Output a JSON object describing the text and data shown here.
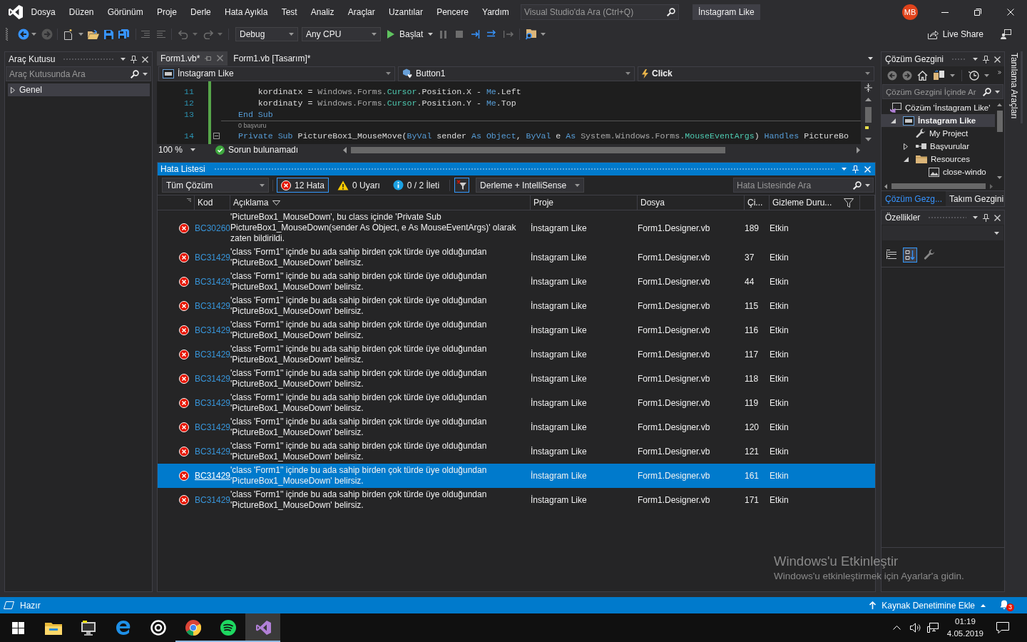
{
  "title_bar": {
    "menu": [
      "Dosya",
      "Düzen",
      "Görünüm",
      "Proje",
      "Derle",
      "Hata Ayıkla",
      "Test",
      "Analiz",
      "Araçlar",
      "Uzantılar",
      "Pencere",
      "Yardım"
    ],
    "search": {
      "placeholder": "Visual Studio'da Ara (Ctrl+Q)"
    },
    "solution_name": "İnstagram Like",
    "avatar": "MB"
  },
  "toolbar": {
    "configuration": "Debug",
    "platform": "Any CPU",
    "start": "Başlat",
    "live_share": "Live Share"
  },
  "toolbox": {
    "title": "Araç Kutusu",
    "search": {
      "placeholder": "Araç Kutusunda Ara"
    },
    "groups": [
      {
        "label": "Genel",
        "expanded": false
      }
    ]
  },
  "editor": {
    "tabs": [
      {
        "label": "Form1.vb*",
        "selected": true
      },
      {
        "label": "Form1.vb [Tasarım]*",
        "selected": false
      }
    ],
    "project": "İnstagram Like",
    "object": "Button1",
    "event": "Click",
    "lines": [
      {
        "number": "11",
        "collapsible": false,
        "tokens": [
          {
            "kind": "plain",
            "text": "    kordinatx = "
          },
          {
            "kind": "namespace",
            "text": "Windows.Forms."
          },
          {
            "kind": "type",
            "text": "Cursor"
          },
          {
            "kind": "plain",
            "text": ".Position.X - "
          },
          {
            "kind": "keyword",
            "text": "Me"
          },
          {
            "kind": "plain",
            "text": ".Left"
          }
        ]
      },
      {
        "number": "12",
        "collapsible": false,
        "tokens": [
          {
            "kind": "plain",
            "text": "    kordinaty = "
          },
          {
            "kind": "namespace",
            "text": "Windows.Forms."
          },
          {
            "kind": "type",
            "text": "Cursor"
          },
          {
            "kind": "plain",
            "text": ".Position.Y - "
          },
          {
            "kind": "keyword",
            "text": "Me"
          },
          {
            "kind": "plain",
            "text": ".Top"
          }
        ]
      },
      {
        "number": "13",
        "collapsible": false,
        "tokens": [
          {
            "kind": "keyword",
            "text": "End Sub"
          }
        ]
      },
      {
        "number": "14",
        "collapsible": true,
        "codelens": "0 başvuru",
        "tokens": [
          {
            "kind": "keyword",
            "text": "Private Sub"
          },
          {
            "kind": "plain",
            "text": " PictureBox1_MouseMove("
          },
          {
            "kind": "keyword",
            "text": "ByVal"
          },
          {
            "kind": "plain",
            "text": " sender "
          },
          {
            "kind": "keyword",
            "text": "As Object"
          },
          {
            "kind": "plain",
            "text": ", "
          },
          {
            "kind": "keyword",
            "text": "ByVal"
          },
          {
            "kind": "plain",
            "text": " e "
          },
          {
            "kind": "keyword",
            "text": "As"
          },
          {
            "kind": "namespace",
            "text": " System.Windows.Forms."
          },
          {
            "kind": "type",
            "text": "MouseEventArgs"
          },
          {
            "kind": "plain",
            "text": ") "
          },
          {
            "kind": "keyword",
            "text": "Handles"
          },
          {
            "kind": "plain",
            "text": " PictureBo"
          }
        ]
      }
    ],
    "zoom": "100 %",
    "status": "Sorun bulunamadı"
  },
  "error_list": {
    "title": "Hata Listesi",
    "scope": "Tüm Çözüm",
    "filters": [
      {
        "kind": "error",
        "label": "12 Hata",
        "selected": true
      },
      {
        "kind": "warning",
        "label": "0 Uyarı",
        "selected": false
      },
      {
        "kind": "info",
        "label": "0 / 2 İleti",
        "selected": false
      }
    ],
    "source": "Derleme + IntelliSense",
    "search": {
      "placeholder": "Hata Listesinde Ara"
    },
    "columns": [
      "Kod",
      "Açıklama",
      "Proje",
      "Dosya",
      "Çi...",
      "Gizleme Duru..."
    ],
    "rows": [
      {
        "code": "BC30260",
        "description": "'PictureBox1_MouseDown', bu class içinde 'Private Sub PictureBox1_MouseDown(sender As Object, e As MouseEventArgs)' olarak zaten bildirildi.",
        "project": "İnstagram Like",
        "file": "Form1.Designer.vb",
        "line": "189",
        "suppression": "Etkin",
        "selected": false
      },
      {
        "code": "BC31429",
        "description": "'class 'Form1'' içinde bu ada sahip birden çok türde üye olduğundan 'PictureBox1_MouseDown' belirsiz.",
        "project": "İnstagram Like",
        "file": "Form1.Designer.vb",
        "line": "37",
        "suppression": "Etkin",
        "selected": false
      },
      {
        "code": "BC31429",
        "description": "'class 'Form1'' içinde bu ada sahip birden çok türde üye olduğundan 'PictureBox1_MouseDown' belirsiz.",
        "project": "İnstagram Like",
        "file": "Form1.Designer.vb",
        "line": "44",
        "suppression": "Etkin",
        "selected": false
      },
      {
        "code": "BC31429",
        "description": "'class 'Form1'' içinde bu ada sahip birden çok türde üye olduğundan 'PictureBox1_MouseDown' belirsiz.",
        "project": "İnstagram Like",
        "file": "Form1.Designer.vb",
        "line": "115",
        "suppression": "Etkin",
        "selected": false
      },
      {
        "code": "BC31429",
        "description": "'class 'Form1'' içinde bu ada sahip birden çok türde üye olduğundan 'PictureBox1_MouseDown' belirsiz.",
        "project": "İnstagram Like",
        "file": "Form1.Designer.vb",
        "line": "116",
        "suppression": "Etkin",
        "selected": false
      },
      {
        "code": "BC31429",
        "description": "'class 'Form1'' içinde bu ada sahip birden çok türde üye olduğundan 'PictureBox1_MouseDown' belirsiz.",
        "project": "İnstagram Like",
        "file": "Form1.Designer.vb",
        "line": "117",
        "suppression": "Etkin",
        "selected": false
      },
      {
        "code": "BC31429",
        "description": "'class 'Form1'' içinde bu ada sahip birden çok türde üye olduğundan 'PictureBox1_MouseDown' belirsiz.",
        "project": "İnstagram Like",
        "file": "Form1.Designer.vb",
        "line": "118",
        "suppression": "Etkin",
        "selected": false
      },
      {
        "code": "BC31429",
        "description": "'class 'Form1'' içinde bu ada sahip birden çok türde üye olduğundan 'PictureBox1_MouseDown' belirsiz.",
        "project": "İnstagram Like",
        "file": "Form1.Designer.vb",
        "line": "119",
        "suppression": "Etkin",
        "selected": false
      },
      {
        "code": "BC31429",
        "description": "'class 'Form1'' içinde bu ada sahip birden çok türde üye olduğundan 'PictureBox1_MouseDown' belirsiz.",
        "project": "İnstagram Like",
        "file": "Form1.Designer.vb",
        "line": "120",
        "suppression": "Etkin",
        "selected": false
      },
      {
        "code": "BC31429",
        "description": "'class 'Form1'' içinde bu ada sahip birden çok türde üye olduğundan 'PictureBox1_MouseDown' belirsiz.",
        "project": "İnstagram Like",
        "file": "Form1.Designer.vb",
        "line": "121",
        "suppression": "Etkin",
        "selected": false
      },
      {
        "code": "BC31429",
        "description": "'class 'Form1'' içinde bu ada sahip birden çok türde üye olduğundan 'PictureBox1_MouseDown' belirsiz.",
        "project": "İnstagram Like",
        "file": "Form1.Designer.vb",
        "line": "161",
        "suppression": "Etkin",
        "selected": true
      },
      {
        "code": "BC31429",
        "description": "'class 'Form1'' içinde bu ada sahip birden çok türde üye olduğundan 'PictureBox1_MouseDown' belirsiz.",
        "project": "İnstagram Like",
        "file": "Form1.Designer.vb",
        "line": "171",
        "suppression": "Etkin",
        "selected": false
      }
    ]
  },
  "solution_explorer": {
    "title": "Çözüm Gezgini",
    "search": {
      "placeholder": "Çözüm Gezgini İçinde Ar"
    },
    "tree": [
      {
        "label": "Çözüm 'İnstagram Like'",
        "kind": "solution",
        "selected": false,
        "children": [
          {
            "label": "İnstagram Like",
            "kind": "project",
            "selected": true,
            "expanded": true,
            "children": [
              {
                "label": "My Project",
                "kind": "settings",
                "selected": false
              },
              {
                "label": "Başvurular",
                "kind": "references",
                "selected": false,
                "expanded": false
              },
              {
                "label": "Resources",
                "kind": "folder",
                "selected": false,
                "expanded": true,
                "children": [
                  {
                    "label": "close-windo",
                    "kind": "image",
                    "selected": false
                  }
                ]
              }
            ]
          }
        ]
      }
    ],
    "tabs": [
      {
        "label": "Çözüm Gezg...",
        "selected": true
      },
      {
        "label": "Takım Gezgini",
        "selected": false
      }
    ]
  },
  "properties": {
    "title": "Özellikler",
    "views": [
      {
        "kind": "categorized",
        "selected": false
      },
      {
        "kind": "alphabetical",
        "selected": true
      },
      {
        "kind": "pages",
        "selected": false
      }
    ]
  },
  "side_dock": {
    "tabs": [
      "Tanılama Araçları"
    ]
  },
  "status_bar": {
    "text": "Hazır",
    "source_control": "Kaynak Denetimine Ekle",
    "notifications": "3"
  },
  "activation": {
    "title": "Windows'u Etkinleştir",
    "text": "Windows'u etkinleştirmek için Ayarlar'a gidin."
  },
  "taskbar": {
    "apps": [
      {
        "kind": "folder",
        "running": false,
        "active": false
      },
      {
        "kind": "monitor",
        "running": false,
        "active": false
      },
      {
        "kind": "letter_e",
        "running": false,
        "active": false
      },
      {
        "kind": "ring",
        "running": false,
        "active": false
      },
      {
        "kind": "wheel",
        "running": true,
        "active": false
      },
      {
        "kind": "waves",
        "running": true,
        "active": false
      },
      {
        "kind": "infinity",
        "running": true,
        "active": true
      }
    ],
    "time": "01:19",
    "date": "4.05.2019"
  }
}
